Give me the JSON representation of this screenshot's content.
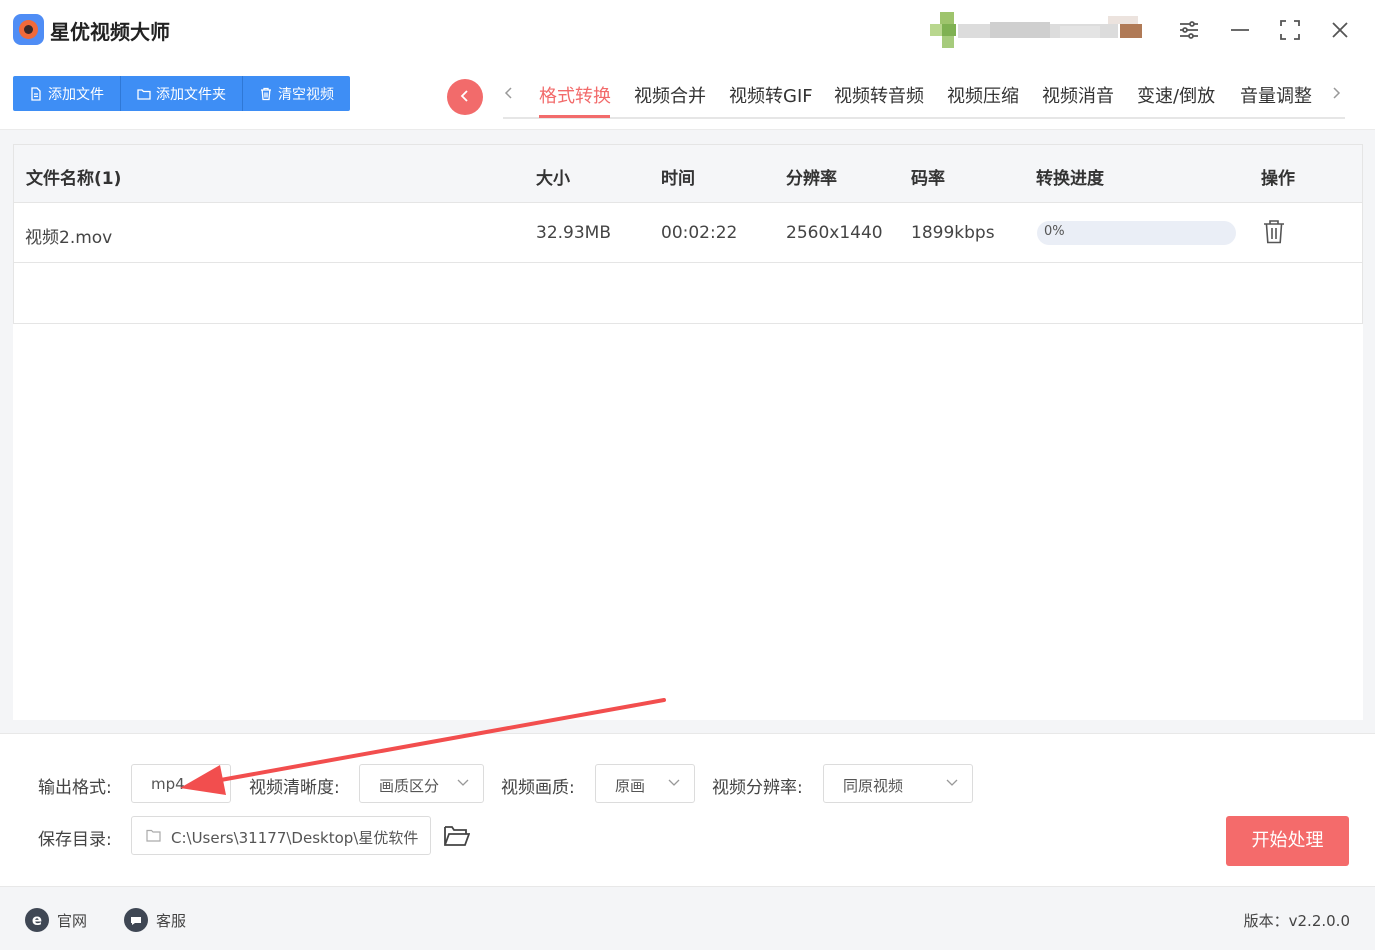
{
  "app": {
    "title": "星优视频大师"
  },
  "toolbar": {
    "add_file": "添加文件",
    "add_folder": "添加文件夹",
    "clear": "清空视频"
  },
  "tabs": [
    {
      "label": "格式转换",
      "active": true
    },
    {
      "label": "视频合并"
    },
    {
      "label": "视频转GIF"
    },
    {
      "label": "视频转音频"
    },
    {
      "label": "视频压缩"
    },
    {
      "label": "视频消音"
    },
    {
      "label": "变速/倒放"
    },
    {
      "label": "音量调整"
    }
  ],
  "table": {
    "headers": [
      "文件名称(1)",
      "大小",
      "时间",
      "分辨率",
      "码率",
      "转换进度",
      "操作"
    ],
    "rows": [
      {
        "name": "视频2.mov",
        "size": "32.93MB",
        "duration": "00:02:22",
        "resolution": "2560x1440",
        "bitrate": "1899kbps",
        "progress": 0,
        "progress_label": "0%"
      }
    ]
  },
  "settings": {
    "output_format_label": "输出格式:",
    "output_format_value": "mp4",
    "clarity_label": "视频清晰度:",
    "clarity_value": "画质区分",
    "quality_label": "视频画质:",
    "quality_value": "原画",
    "resolution_label": "视频分辨率:",
    "resolution_value": "同原视频",
    "save_dir_label": "保存目录:",
    "save_dir_value": "C:\\Users\\31177\\Desktop\\星优软件",
    "start_button": "开始处理"
  },
  "footer": {
    "website": "官网",
    "service": "客服",
    "version": "版本：v2.2.0.0"
  },
  "colors": {
    "accent_blue": "#3e8ef5",
    "accent_red": "#f26b6b"
  },
  "icons": [
    "logo-icon",
    "file-icon",
    "folder-icon",
    "trash-icon",
    "chevron-left-icon",
    "chevron-right-icon",
    "settings-sliders-icon",
    "minimize-icon",
    "maximize-icon",
    "close-icon",
    "chevron-down-icon",
    "open-folder-icon",
    "ie-icon",
    "chat-icon"
  ]
}
